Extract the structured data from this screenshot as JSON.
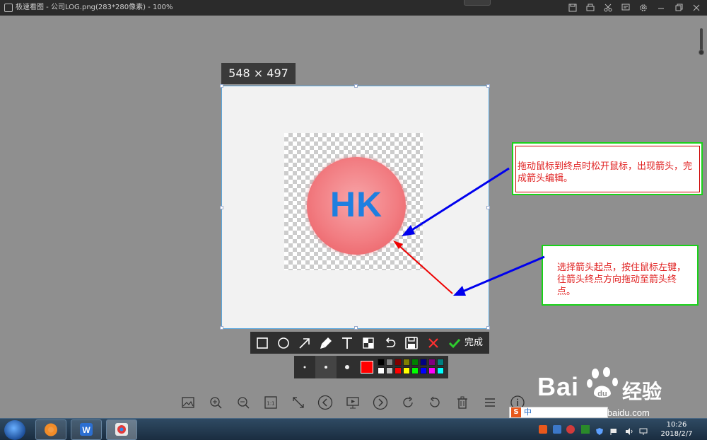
{
  "window": {
    "title": "极速看图 - 公司LOG.png(283*280像素) - 100%"
  },
  "image": {
    "dimension_label": "548 × 497",
    "logo_text": "HK"
  },
  "annotations": {
    "note1": "拖动鼠标到终点时松开鼠标，出现箭头，完成箭头编辑。",
    "note2": "选择箭头起点，按住鼠标左键，往箭头终点方向拖动至箭头终点。"
  },
  "edit_toolbar": {
    "tools": [
      "rectangle-tool",
      "ellipse-tool",
      "arrow-tool",
      "brush-tool",
      "text-tool",
      "mosaic-tool",
      "undo-tool",
      "save-tool",
      "cancel-tool",
      "confirm-tool"
    ],
    "done_label": "完成",
    "selected_color": "#ff0000",
    "palette": [
      "#000000",
      "#808080",
      "#800000",
      "#808000",
      "#008000",
      "#000080",
      "#800080",
      "#008080",
      "#ffffff",
      "#c0c0c0",
      "#ff0000",
      "#ffff00",
      "#00ff00",
      "#0000ff",
      "#ff00ff",
      "#00ffff"
    ]
  },
  "bottom_toolbar": {
    "buttons": [
      "image-icon",
      "zoom-in-icon",
      "zoom-out-icon",
      "actual-size-icon",
      "fit-icon",
      "prev-icon",
      "slideshow-icon",
      "next-icon",
      "rotate-right-icon",
      "rotate-left-icon",
      "delete-icon",
      "menu-icon",
      "info-icon"
    ],
    "actual_size_label": "1:1"
  },
  "watermark": {
    "brand": "Bai",
    "brand_suffix": "经验",
    "url": "jingyan.baidu.com"
  },
  "taskbar": {
    "time": "10:26",
    "date": "2018/2/7",
    "ime_label": "中"
  },
  "colors": {
    "arrow_blue": "#0000ee",
    "arrow_red": "#ee0000",
    "note_border": "#19d219",
    "selection_border": "#5aa8e0"
  }
}
